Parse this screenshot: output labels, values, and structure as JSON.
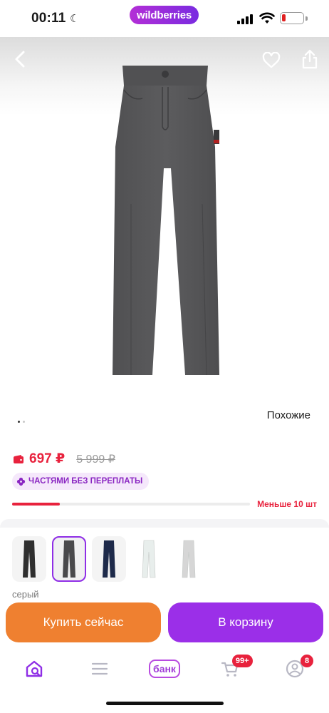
{
  "status_bar": {
    "time": "00:11",
    "brand": "wildberries"
  },
  "product": {
    "similar_label": "Похожие",
    "price_current": "697 ₽",
    "price_old": "5 999 ₽",
    "installments_label": "ЧАСТЯМИ БЕЗ ПЕРЕПЛАТЫ",
    "stock_text": "Меньше 10 шт",
    "stock_level_fraction": 0.2,
    "color_label": "серый",
    "image_dots": {
      "count": 2,
      "active": 0
    }
  },
  "variants": [
    {
      "name": "black",
      "color": "#2f2f2f",
      "selected": false
    },
    {
      "name": "grey",
      "color": "#4a4a4c",
      "selected": true
    },
    {
      "name": "navy",
      "color": "#1e2a4a",
      "selected": false
    },
    {
      "name": "white",
      "color": "#e8eeec",
      "selected": false
    },
    {
      "name": "light-grey",
      "color": "#d6d6d6",
      "selected": false
    }
  ],
  "actions": {
    "buy_now": "Купить сейчас",
    "add_to_cart": "В корзину"
  },
  "tabbar": {
    "bank_label": "банк",
    "cart_badge": "99+",
    "profile_badge": "8"
  },
  "colors": {
    "accent_purple": "#9b2fe8",
    "accent_orange": "#ef8030",
    "price_red": "#e8223d",
    "product_grey": "#58585a"
  },
  "icons": [
    "back-arrow-icon",
    "heart-icon",
    "share-icon",
    "wallet-icon",
    "installments-plus-icon",
    "home-search-icon",
    "menu-icon",
    "cart-icon",
    "profile-icon"
  ]
}
